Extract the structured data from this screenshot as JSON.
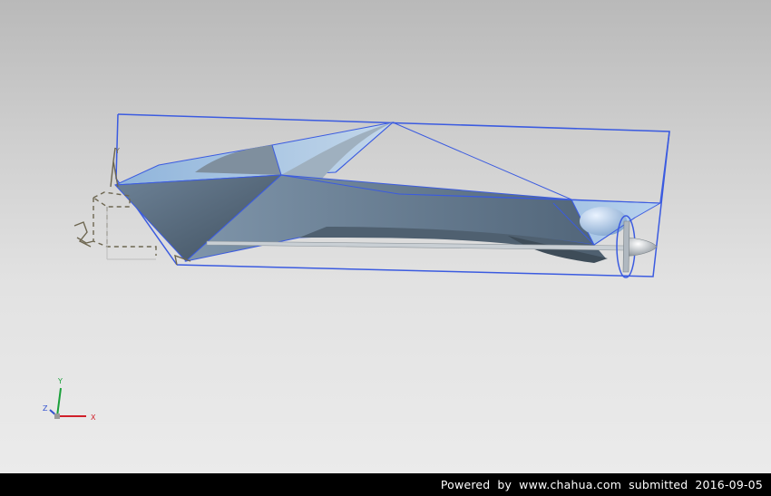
{
  "viewport": {
    "background_top": "#b9b9b9",
    "background_bottom": "#ebebeb",
    "bounding_box_color": "#3b5be0",
    "surface_light_color": "#a9c4e0",
    "surface_dark_color": "#56687a",
    "wireframe_color": "#6d6650"
  },
  "model": {
    "csys_axis_label": "Y"
  },
  "triad": {
    "x_label": "X",
    "y_label": "Y",
    "z_label": "Z",
    "x_color": "#d0202a",
    "y_color": "#1aa03a",
    "z_color": "#3050d0"
  },
  "footer": {
    "powered_label": "Powered",
    "by_label": "by",
    "site": "www.chahua.com",
    "submitted_label": "submitted",
    "date": "2016-09-05"
  }
}
